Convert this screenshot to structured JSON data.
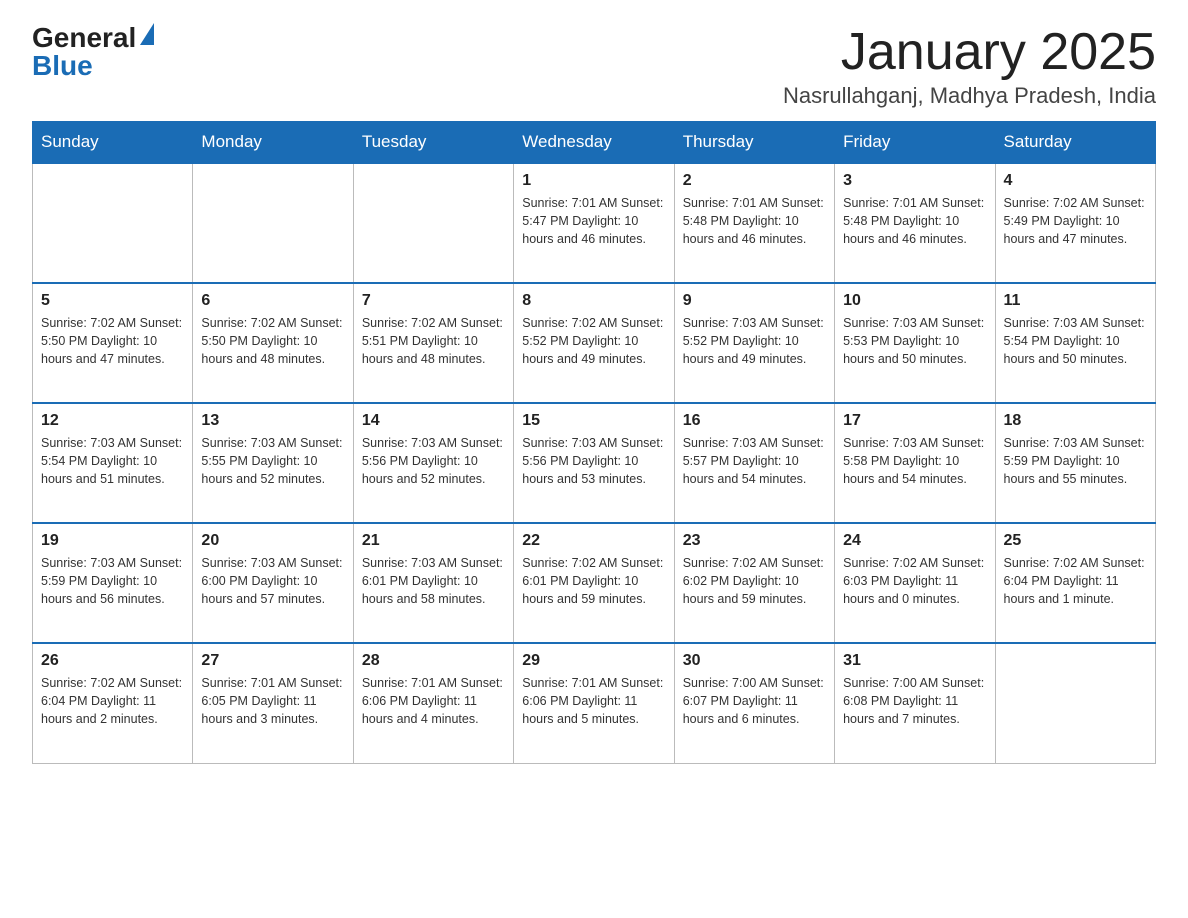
{
  "header": {
    "logo": {
      "general": "General",
      "blue": "Blue"
    },
    "title": "January 2025",
    "subtitle": "Nasrullahganj, Madhya Pradesh, India"
  },
  "days_of_week": [
    "Sunday",
    "Monday",
    "Tuesday",
    "Wednesday",
    "Thursday",
    "Friday",
    "Saturday"
  ],
  "weeks": [
    [
      {
        "day": "",
        "info": ""
      },
      {
        "day": "",
        "info": ""
      },
      {
        "day": "",
        "info": ""
      },
      {
        "day": "1",
        "info": "Sunrise: 7:01 AM\nSunset: 5:47 PM\nDaylight: 10 hours and 46 minutes."
      },
      {
        "day": "2",
        "info": "Sunrise: 7:01 AM\nSunset: 5:48 PM\nDaylight: 10 hours and 46 minutes."
      },
      {
        "day": "3",
        "info": "Sunrise: 7:01 AM\nSunset: 5:48 PM\nDaylight: 10 hours and 46 minutes."
      },
      {
        "day": "4",
        "info": "Sunrise: 7:02 AM\nSunset: 5:49 PM\nDaylight: 10 hours and 47 minutes."
      }
    ],
    [
      {
        "day": "5",
        "info": "Sunrise: 7:02 AM\nSunset: 5:50 PM\nDaylight: 10 hours and 47 minutes."
      },
      {
        "day": "6",
        "info": "Sunrise: 7:02 AM\nSunset: 5:50 PM\nDaylight: 10 hours and 48 minutes."
      },
      {
        "day": "7",
        "info": "Sunrise: 7:02 AM\nSunset: 5:51 PM\nDaylight: 10 hours and 48 minutes."
      },
      {
        "day": "8",
        "info": "Sunrise: 7:02 AM\nSunset: 5:52 PM\nDaylight: 10 hours and 49 minutes."
      },
      {
        "day": "9",
        "info": "Sunrise: 7:03 AM\nSunset: 5:52 PM\nDaylight: 10 hours and 49 minutes."
      },
      {
        "day": "10",
        "info": "Sunrise: 7:03 AM\nSunset: 5:53 PM\nDaylight: 10 hours and 50 minutes."
      },
      {
        "day": "11",
        "info": "Sunrise: 7:03 AM\nSunset: 5:54 PM\nDaylight: 10 hours and 50 minutes."
      }
    ],
    [
      {
        "day": "12",
        "info": "Sunrise: 7:03 AM\nSunset: 5:54 PM\nDaylight: 10 hours and 51 minutes."
      },
      {
        "day": "13",
        "info": "Sunrise: 7:03 AM\nSunset: 5:55 PM\nDaylight: 10 hours and 52 minutes."
      },
      {
        "day": "14",
        "info": "Sunrise: 7:03 AM\nSunset: 5:56 PM\nDaylight: 10 hours and 52 minutes."
      },
      {
        "day": "15",
        "info": "Sunrise: 7:03 AM\nSunset: 5:56 PM\nDaylight: 10 hours and 53 minutes."
      },
      {
        "day": "16",
        "info": "Sunrise: 7:03 AM\nSunset: 5:57 PM\nDaylight: 10 hours and 54 minutes."
      },
      {
        "day": "17",
        "info": "Sunrise: 7:03 AM\nSunset: 5:58 PM\nDaylight: 10 hours and 54 minutes."
      },
      {
        "day": "18",
        "info": "Sunrise: 7:03 AM\nSunset: 5:59 PM\nDaylight: 10 hours and 55 minutes."
      }
    ],
    [
      {
        "day": "19",
        "info": "Sunrise: 7:03 AM\nSunset: 5:59 PM\nDaylight: 10 hours and 56 minutes."
      },
      {
        "day": "20",
        "info": "Sunrise: 7:03 AM\nSunset: 6:00 PM\nDaylight: 10 hours and 57 minutes."
      },
      {
        "day": "21",
        "info": "Sunrise: 7:03 AM\nSunset: 6:01 PM\nDaylight: 10 hours and 58 minutes."
      },
      {
        "day": "22",
        "info": "Sunrise: 7:02 AM\nSunset: 6:01 PM\nDaylight: 10 hours and 59 minutes."
      },
      {
        "day": "23",
        "info": "Sunrise: 7:02 AM\nSunset: 6:02 PM\nDaylight: 10 hours and 59 minutes."
      },
      {
        "day": "24",
        "info": "Sunrise: 7:02 AM\nSunset: 6:03 PM\nDaylight: 11 hours and 0 minutes."
      },
      {
        "day": "25",
        "info": "Sunrise: 7:02 AM\nSunset: 6:04 PM\nDaylight: 11 hours and 1 minute."
      }
    ],
    [
      {
        "day": "26",
        "info": "Sunrise: 7:02 AM\nSunset: 6:04 PM\nDaylight: 11 hours and 2 minutes."
      },
      {
        "day": "27",
        "info": "Sunrise: 7:01 AM\nSunset: 6:05 PM\nDaylight: 11 hours and 3 minutes."
      },
      {
        "day": "28",
        "info": "Sunrise: 7:01 AM\nSunset: 6:06 PM\nDaylight: 11 hours and 4 minutes."
      },
      {
        "day": "29",
        "info": "Sunrise: 7:01 AM\nSunset: 6:06 PM\nDaylight: 11 hours and 5 minutes."
      },
      {
        "day": "30",
        "info": "Sunrise: 7:00 AM\nSunset: 6:07 PM\nDaylight: 11 hours and 6 minutes."
      },
      {
        "day": "31",
        "info": "Sunrise: 7:00 AM\nSunset: 6:08 PM\nDaylight: 11 hours and 7 minutes."
      },
      {
        "day": "",
        "info": ""
      }
    ]
  ]
}
